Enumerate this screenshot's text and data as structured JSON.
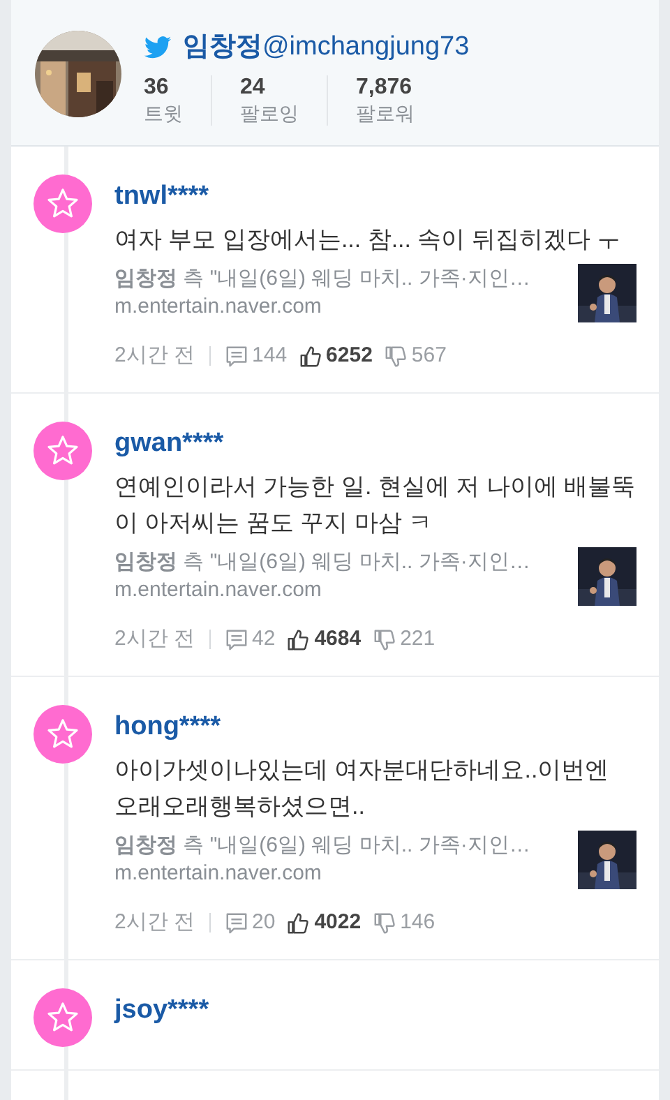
{
  "profile": {
    "name": "임창정",
    "handle": "@imchangjung73",
    "stats": [
      {
        "value": "36",
        "label": "트윗"
      },
      {
        "value": "24",
        "label": "팔로잉"
      },
      {
        "value": "7,876",
        "label": "팔로워"
      }
    ]
  },
  "comments": [
    {
      "user": "tnwl****",
      "text": "여자 부모 입장에서는... 참... 속이 뒤집히겠다 ㅜ",
      "preview": {
        "title": "**임창정** 측 \"내일(6일) 웨딩 마치.. 가족·지인…",
        "domain": "m.entertain.naver.com"
      },
      "time": "2시간 전",
      "replies": "144",
      "likes": "6252",
      "dislikes": "567"
    },
    {
      "user": "gwan****",
      "text": "연예인이라서 가능한 일. 현실에 저 나이에 배불뚝이 아저씨는 꿈도 꾸지 마삼 ㅋ",
      "preview": {
        "title": "**임창정** 측 \"내일(6일) 웨딩 마치.. 가족·지인…",
        "domain": "m.entertain.naver.com"
      },
      "time": "2시간 전",
      "replies": "42",
      "likes": "4684",
      "dislikes": "221"
    },
    {
      "user": "hong****",
      "text": "아이가셋이나있는데 여자분대단하네요..이번엔 오래오래행복하셨으면..",
      "preview": {
        "title": "**임창정** 측 \"내일(6일) 웨딩 마치.. 가족·지인…",
        "domain": "m.entertain.naver.com"
      },
      "time": "2시간 전",
      "replies": "20",
      "likes": "4022",
      "dislikes": "146"
    },
    {
      "user": "jsoy****"
    }
  ]
}
